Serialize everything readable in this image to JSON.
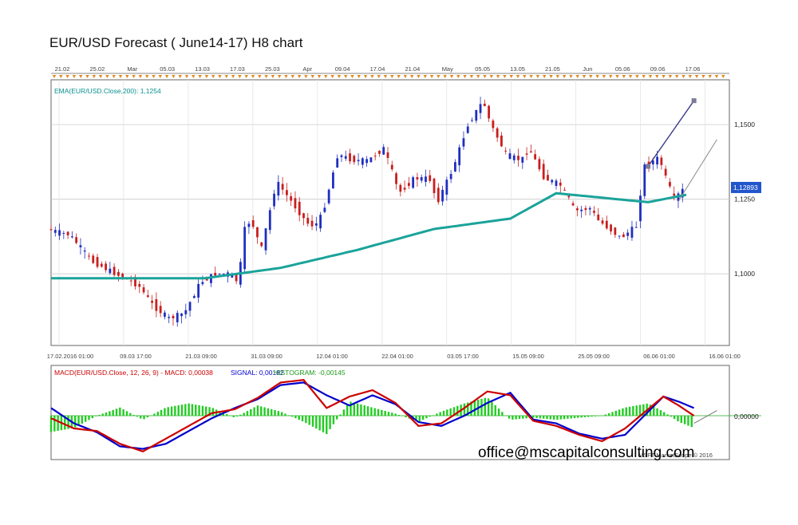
{
  "title": "EUR/USD Forecast ( June14-17) H8 chart",
  "email": "office@mscapitalconsulting.com",
  "copyright": "MSFT MarketScope © 2016",
  "chart_data": [
    {
      "type": "candlestick",
      "title": "EUR/USD Forecast ( June14-17) H8 chart",
      "ylim": [
        1.076,
        1.165
      ],
      "y_ticks": [
        "1,1500",
        "1,1250",
        "1,1000"
      ],
      "y_tick_values": [
        1.15,
        1.125,
        1.1
      ],
      "current_price_label": "1,12893",
      "current_price": 1.12893,
      "top_date_labels": [
        "21.02",
        "25.02",
        "Mar",
        "05.03",
        "13.03",
        "17.03",
        "25.03",
        "Apr",
        "09.04",
        "17.04",
        "21.04",
        "May",
        "05.05",
        "13.05",
        "21.05",
        "Jun",
        "05.06",
        "09.06",
        "17.06"
      ],
      "bottom_date_labels": [
        "17.02.2016 01:00",
        "09.03 17:00",
        "21.03 09:00",
        "31.03 09:00",
        "12.04 01:00",
        "22.04 01:00",
        "03.05 17:00",
        "15.05 09:00",
        "25.05 09:00",
        "06.06 01:00",
        "16.06 01:00"
      ],
      "indicator_label": "EMA(EUR/USD.Close,200): 1,1254",
      "price_path": [
        [
          0,
          1.115
        ],
        [
          3,
          1.113
        ],
        [
          6,
          1.104
        ],
        [
          9,
          1.1
        ],
        [
          12,
          1.096
        ],
        [
          14,
          1.089
        ],
        [
          16,
          1.085
        ],
        [
          18,
          1.087
        ],
        [
          20,
          1.097
        ],
        [
          22,
          1.1
        ],
        [
          24,
          1.1
        ],
        [
          25,
          1.097
        ],
        [
          26,
          1.118
        ],
        [
          27,
          1.116
        ],
        [
          28,
          1.108
        ],
        [
          30,
          1.131
        ],
        [
          32,
          1.124
        ],
        [
          34,
          1.117
        ],
        [
          35,
          1.116
        ],
        [
          36,
          1.12
        ],
        [
          38,
          1.14
        ],
        [
          40,
          1.138
        ],
        [
          42,
          1.138
        ],
        [
          44,
          1.142
        ],
        [
          45,
          1.135
        ],
        [
          46,
          1.127
        ],
        [
          48,
          1.132
        ],
        [
          50,
          1.132
        ],
        [
          51,
          1.124
        ],
        [
          53,
          1.135
        ],
        [
          55,
          1.15
        ],
        [
          57,
          1.158
        ],
        [
          58,
          1.15
        ],
        [
          60,
          1.14
        ],
        [
          62,
          1.138
        ],
        [
          63,
          1.142
        ],
        [
          65,
          1.132
        ],
        [
          67,
          1.13
        ],
        [
          68,
          1.126
        ],
        [
          69,
          1.121
        ],
        [
          71,
          1.122
        ],
        [
          72,
          1.118
        ],
        [
          74,
          1.114
        ],
        [
          75,
          1.112
        ],
        [
          77,
          1.116
        ],
        [
          78,
          1.136
        ],
        [
          80,
          1.139
        ],
        [
          81,
          1.131
        ],
        [
          82,
          1.125
        ],
        [
          83,
          1.128
        ]
      ],
      "ema_path": [
        [
          0,
          1.0985
        ],
        [
          10,
          1.0985
        ],
        [
          20,
          1.0985
        ],
        [
          30,
          1.102
        ],
        [
          40,
          1.108
        ],
        [
          50,
          1.115
        ],
        [
          60,
          1.1185
        ],
        [
          66,
          1.127
        ],
        [
          72,
          1.1255
        ],
        [
          78,
          1.124
        ],
        [
          83,
          1.1265
        ]
      ],
      "forecast_lines": [
        {
          "from": [
            78,
            1.136
          ],
          "to": [
            84,
            1.158
          ]
        },
        {
          "from": [
            82,
            1.1245
          ],
          "to": [
            87,
            1.145
          ]
        }
      ]
    },
    {
      "type": "line",
      "title": "MACD(EUR/USD.Close, 12, 26, 9) - MACD: 0,00038 SIGNAL: 0,00182 HISTOGRAM: -0,00145",
      "label_macd": "MACD(EUR/USD.Close, 12, 26, 9) -  MACD: 0,00038",
      "label_signal": "SIGNAL: 0,00182",
      "label_histogram": "HISTOGRAM: -0,00145",
      "zero_label": "0,00000",
      "colors": {
        "macd": "#cc0000",
        "signal": "#0000cc",
        "histogram": "#22cc22"
      },
      "series": [
        {
          "name": "MACD",
          "values": [
            [
              0,
              -0.2
            ],
            [
              3,
              -1
            ],
            [
              6,
              -1.2
            ],
            [
              9,
              -2.2
            ],
            [
              12,
              -2.8
            ],
            [
              15,
              -1.8
            ],
            [
              18,
              -0.8
            ],
            [
              21,
              0.2
            ],
            [
              24,
              0.5
            ],
            [
              27,
              1.4
            ],
            [
              30,
              2.6
            ],
            [
              33,
              2.8
            ],
            [
              36,
              0.6
            ],
            [
              39,
              1.5
            ],
            [
              42,
              2
            ],
            [
              45,
              1
            ],
            [
              48,
              -0.8
            ],
            [
              51,
              -0.6
            ],
            [
              54,
              0.6
            ],
            [
              57,
              1.9
            ],
            [
              60,
              1.6
            ],
            [
              63,
              -0.4
            ],
            [
              66,
              -0.8
            ],
            [
              69,
              -1.5
            ],
            [
              72,
              -2
            ],
            [
              75,
              -1
            ],
            [
              78,
              0.5
            ],
            [
              80,
              1.5
            ],
            [
              82,
              0.8
            ],
            [
              84,
              0
            ]
          ]
        },
        {
          "name": "SIGNAL",
          "values": [
            [
              0,
              0.6
            ],
            [
              3,
              -0.6
            ],
            [
              6,
              -1.3
            ],
            [
              9,
              -2.4
            ],
            [
              12,
              -2.6
            ],
            [
              15,
              -2.2
            ],
            [
              18,
              -1.2
            ],
            [
              21,
              -0.2
            ],
            [
              24,
              0.6
            ],
            [
              27,
              1.3
            ],
            [
              30,
              2.4
            ],
            [
              33,
              2.6
            ],
            [
              36,
              1.6
            ],
            [
              39,
              0.8
            ],
            [
              42,
              1.6
            ],
            [
              45,
              0.9
            ],
            [
              48,
              -0.5
            ],
            [
              51,
              -0.8
            ],
            [
              54,
              0
            ],
            [
              57,
              1
            ],
            [
              60,
              1.8
            ],
            [
              63,
              -0.3
            ],
            [
              66,
              -0.6
            ],
            [
              69,
              -1.4
            ],
            [
              72,
              -1.8
            ],
            [
              75,
              -1.5
            ],
            [
              78,
              0.3
            ],
            [
              80,
              1.5
            ],
            [
              82,
              1.1
            ],
            [
              84,
              0.6
            ]
          ]
        },
        {
          "name": "HISTOGRAM",
          "values": [
            [
              0,
              -0.8
            ],
            [
              3,
              -0.6
            ],
            [
              6,
              0
            ],
            [
              9,
              0.4
            ],
            [
              12,
              -0.2
            ],
            [
              15,
              0.4
            ],
            [
              18,
              0.6
            ],
            [
              21,
              0.4
            ],
            [
              24,
              -0.1
            ],
            [
              27,
              0.5
            ],
            [
              30,
              0.2
            ],
            [
              33,
              -0.3
            ],
            [
              36,
              -0.9
            ],
            [
              39,
              0.7
            ],
            [
              42,
              0.4
            ],
            [
              45,
              0.1
            ],
            [
              48,
              -0.3
            ],
            [
              51,
              0.2
            ],
            [
              54,
              0.6
            ],
            [
              57,
              0.9
            ],
            [
              60,
              -0.2
            ],
            [
              63,
              -0.1
            ],
            [
              66,
              -0.2
            ],
            [
              69,
              -0.1
            ],
            [
              72,
              0
            ],
            [
              75,
              0.4
            ],
            [
              78,
              0.6
            ],
            [
              80,
              0.2
            ],
            [
              82,
              -0.3
            ],
            [
              84,
              -0.6
            ]
          ]
        }
      ],
      "forecast_line": {
        "from": [
          84,
          -0.6
        ],
        "to": [
          87,
          0.4
        ]
      }
    }
  ]
}
